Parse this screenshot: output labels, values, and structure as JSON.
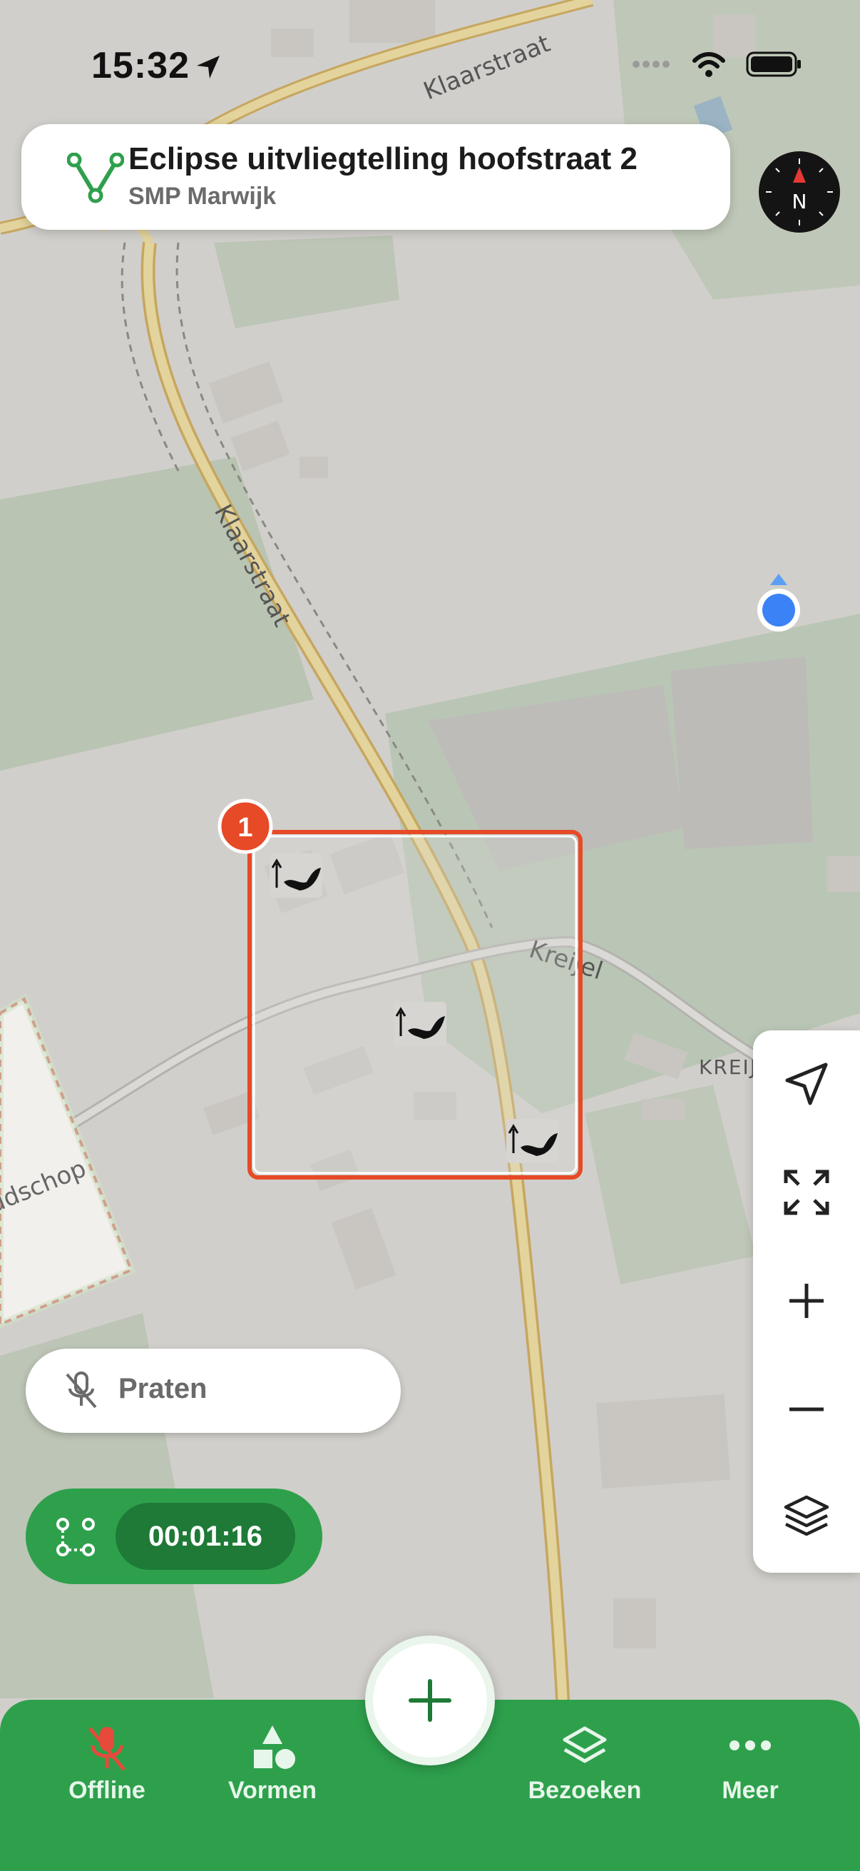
{
  "status_bar": {
    "time": "15:32"
  },
  "header": {
    "title": "Eclipse uitvliegtelling hoofstraat 2",
    "subtitle": "SMP Marwijk",
    "icon": "route-icon"
  },
  "compass": {
    "label": "N"
  },
  "map": {
    "street_labels": [
      "Klaarstraat",
      "Klaarstraat",
      "Kreijel",
      "KREIJ",
      "udschop"
    ],
    "selection_badge": "1",
    "bat_markers": 3
  },
  "right_toolbar": {
    "items": [
      "location-arrow-icon",
      "expand-icon",
      "zoom-in-icon",
      "zoom-out-icon",
      "layers-icon"
    ]
  },
  "talk_button": {
    "label": "Praten"
  },
  "timer": {
    "value": "00:01:16"
  },
  "bottom_nav": {
    "items": [
      {
        "label": "Offline",
        "icon": "mic-off-icon"
      },
      {
        "label": "Vormen",
        "icon": "shapes-icon"
      },
      {
        "label": "Bezoeken",
        "icon": "layers-icon"
      },
      {
        "label": "Meer",
        "icon": "more-icon"
      }
    ]
  },
  "colors": {
    "accent_green": "#2ea04c",
    "timer_dark_green": "#1e7a36",
    "selection_orange": "#e64a27",
    "location_blue": "#3b82f6"
  }
}
